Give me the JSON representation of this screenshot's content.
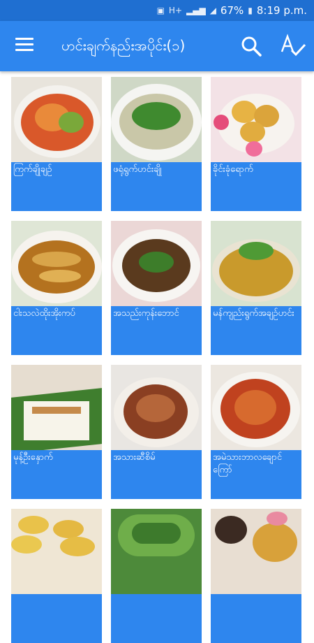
{
  "status_bar": {
    "battery": "67%",
    "time": "8:19 p.m.",
    "network": "H+"
  },
  "app_bar": {
    "title": "ဟင်းချက်နည်းအပိုင်း(၁)",
    "menu_icon": "hamburger-menu-icon",
    "search_icon": "search-icon",
    "font_icon": "spellcheck-az-icon"
  },
  "colors": {
    "primary": "#2e86ee",
    "status_bar": "#1f6fd1",
    "card_bg": "#2e86ee"
  },
  "recipes": [
    {
      "name": "ကြက်ချိုချဉ်"
    },
    {
      "name": "ဖရုံရွက်ဟင်းချို"
    },
    {
      "name": "ခိုင်းခုံရောက်"
    },
    {
      "name": "ငါးသလဲထိုးအိုးကပ်"
    },
    {
      "name": "အသည်းကုန်းဘောင်"
    },
    {
      "name": "မန်ကျည်းရွက်အချဉ်ဟင်း"
    },
    {
      "name": "မုန့်ဦးနှောက်"
    },
    {
      "name": "အသားဆီစိမ်"
    },
    {
      "name": "အမဲသားဘာလချောင်ကြော်"
    },
    {
      "name": ""
    },
    {
      "name": ""
    },
    {
      "name": ""
    }
  ]
}
